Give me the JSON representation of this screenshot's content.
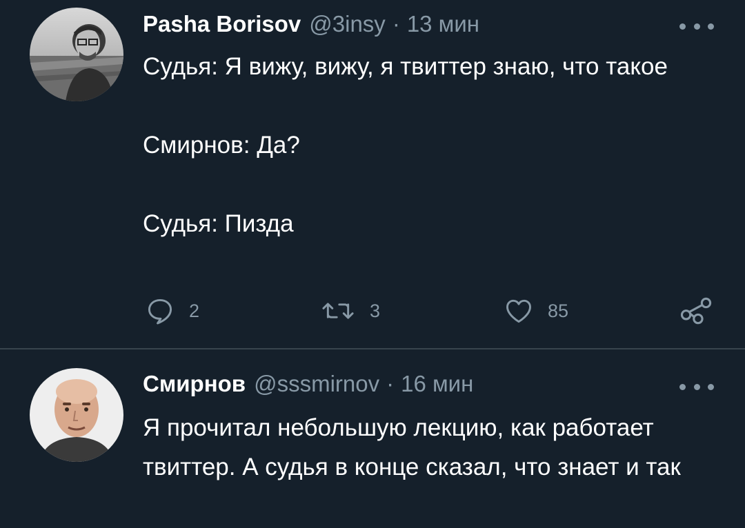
{
  "tweets": [
    {
      "name": "Pasha Borisov",
      "handle": "@3insy",
      "separator": "·",
      "time": "13 мин",
      "avatar_icon": "user-avatar-photo",
      "text_paragraphs": [
        "Судья: Я вижу, вижу, я твиттер знаю, что такое",
        "Смирнов: Да?",
        "Судья: Пизда"
      ],
      "actions": {
        "reply_count": "2",
        "retweet_count": "3",
        "like_count": "85"
      }
    },
    {
      "name": "Смирнов",
      "handle": "@sssmirnov",
      "separator": "·",
      "time": "16 мин",
      "avatar_icon": "user-avatar-photo",
      "text_paragraphs": [
        "Я прочитал небольшую лекцию, как работает твиттер. А судья в конце сказал, что знает и так"
      ]
    }
  ],
  "colors": {
    "background": "#15202b",
    "text_primary": "#ffffff",
    "text_secondary": "#8899a6",
    "divider": "#38444d"
  }
}
